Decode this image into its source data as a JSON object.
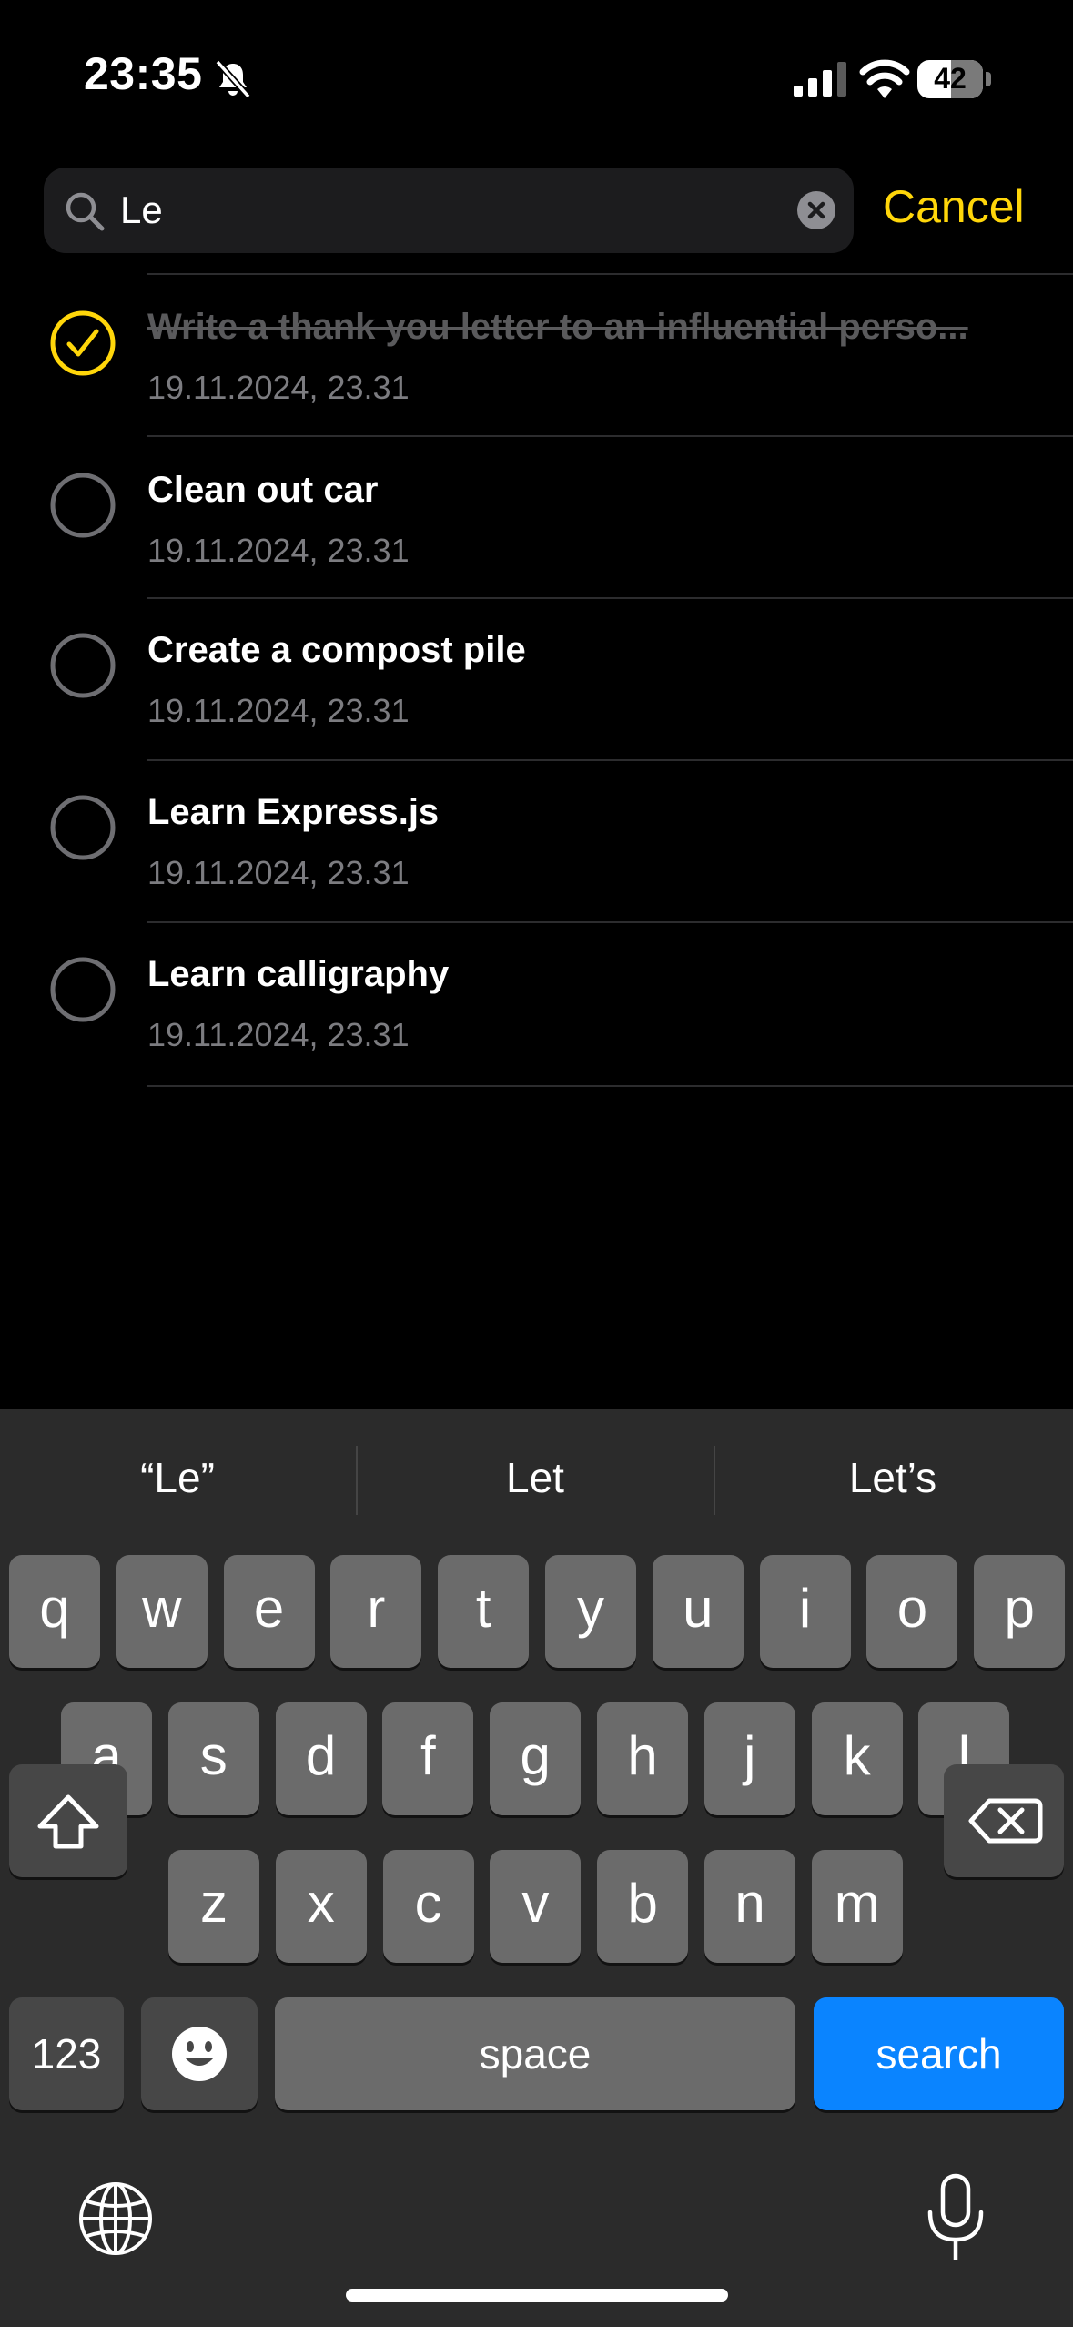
{
  "status_bar": {
    "time": "23:35",
    "battery": "42",
    "icons": [
      "bell-slash-icon",
      "cellular-signal-icon",
      "wifi-icon",
      "battery-icon"
    ]
  },
  "search": {
    "query": "Le",
    "cancel_label": "Cancel",
    "icons": [
      "search-icon",
      "clear-icon"
    ]
  },
  "colors": {
    "accent": "#ffd60a",
    "background": "#000000",
    "search_key": "#0a84ff"
  },
  "tasks": [
    {
      "title": "Write a thank you letter to an influential perso...",
      "date": "19.11.2024, 23.31",
      "completed": true
    },
    {
      "title": "Clean out car",
      "date": "19.11.2024, 23.31",
      "completed": false
    },
    {
      "title": "Create a compost pile",
      "date": "19.11.2024, 23.31",
      "completed": false
    },
    {
      "title": "Learn Express.js",
      "date": "19.11.2024, 23.31",
      "completed": false
    },
    {
      "title": "Learn calligraphy",
      "date": "19.11.2024, 23.31",
      "completed": false
    }
  ],
  "keyboard": {
    "suggestions": [
      "“Le”",
      "Let",
      "Let’s"
    ],
    "row1": [
      "q",
      "w",
      "e",
      "r",
      "t",
      "y",
      "u",
      "i",
      "o",
      "p"
    ],
    "row2": [
      "a",
      "s",
      "d",
      "f",
      "g",
      "h",
      "j",
      "k",
      "l"
    ],
    "row3": [
      "z",
      "x",
      "c",
      "v",
      "b",
      "n",
      "m"
    ],
    "numbers_label": "123",
    "space_label": "space",
    "search_label": "search",
    "icons": [
      "shift-icon",
      "delete-icon",
      "emoji-icon",
      "globe-icon",
      "microphone-icon"
    ]
  }
}
